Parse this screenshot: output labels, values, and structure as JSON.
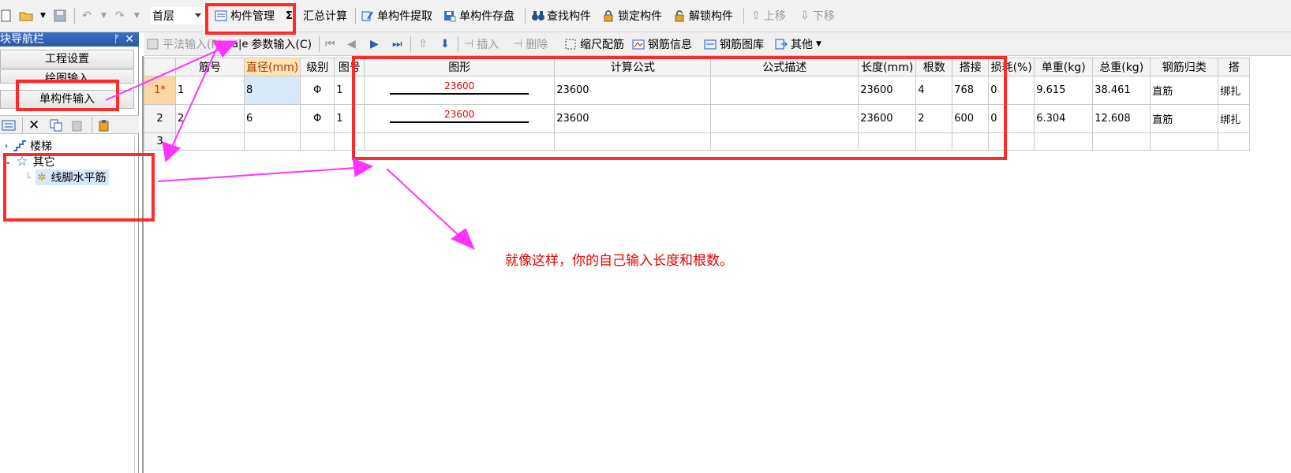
{
  "toolbar": {
    "floor_select": "首层",
    "buttons": {
      "component_manage": "构件管理",
      "summary_calc": "汇总计算",
      "single_extract": "单构件提取",
      "single_save": "单构件存盘",
      "find_component": "查找构件",
      "lock_component": "锁定构件",
      "unlock_component": "解锁构件",
      "move_up": "上移",
      "move_down": "下移"
    }
  },
  "toolbar2": {
    "flat_input": "平法输入(P)",
    "param_input": "参数输入(C)",
    "insert": "插入",
    "delete": "删除",
    "scale_rebar": "缩尺配筋",
    "rebar_info": "钢筋信息",
    "rebar_library": "钢筋图库",
    "other": "其他"
  },
  "nav": {
    "title": "模块导航栏",
    "pin": "ᚠ",
    "close": "✕",
    "project_settings": "工程设置",
    "drawing_input": "绘图输入",
    "single_input": "单构件输入",
    "tree": {
      "stairs": "楼梯",
      "other": "其它",
      "leaf": "线脚水平筋"
    }
  },
  "grid": {
    "columns": [
      "",
      "筋号",
      "直径(mm)",
      "级别",
      "图号",
      "图形",
      "计算公式",
      "公式描述",
      "长度(mm)",
      "根数",
      "搭接",
      "损耗(%)",
      "单重(kg)",
      "总重(kg)",
      "钢筋归类",
      "搭"
    ],
    "rows": [
      {
        "num": "1*",
        "bar_no": "1",
        "diameter": "8",
        "grade": "Φ",
        "shape_no": "1",
        "shape_label": "23600",
        "formula": "23600",
        "desc": "",
        "length": "23600",
        "count": "4",
        "lap": "768",
        "loss": "0",
        "unit_weight": "9.615",
        "total_weight": "38.461",
        "category": "直筋",
        "last": "绑扎"
      },
      {
        "num": "2",
        "bar_no": "2",
        "diameter": "6",
        "grade": "Φ",
        "shape_no": "1",
        "shape_label": "23600",
        "formula": "23600",
        "desc": "",
        "length": "23600",
        "count": "2",
        "lap": "600",
        "loss": "0",
        "unit_weight": "6.304",
        "total_weight": "12.608",
        "category": "直筋",
        "last": "绑扎"
      },
      {
        "num": "3"
      }
    ]
  },
  "note": "就像这样，你的自己输入长度和根数。",
  "colors": {
    "annotation_red": "#ff2a2a",
    "arrow_magenta": "#ff33ff",
    "note_red": "#e60000"
  }
}
